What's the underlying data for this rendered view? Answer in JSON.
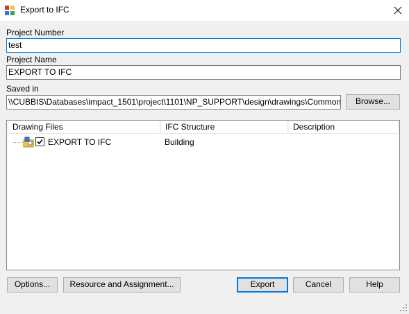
{
  "window": {
    "title": "Export to IFC"
  },
  "form": {
    "project_number_label": "Project Number",
    "project_number_value": "test",
    "project_name_label": "Project Name",
    "project_name_value": "EXPORT TO IFC",
    "saved_in_label": "Saved in",
    "saved_in_value": "\\\\CUBBIS\\Databases\\impact_1501\\project\\1101\\NP_SUPPORT\\design\\drawings\\Common drawin",
    "browse_label": "Browse..."
  },
  "list": {
    "columns": [
      "Drawing Files",
      "IFC Structure",
      "Description"
    ],
    "rows": [
      {
        "name": "EXPORT TO IFC",
        "structure": "Building",
        "description": "",
        "checked": true
      }
    ]
  },
  "buttons": {
    "options": "Options...",
    "resource": "Resource and Assignment...",
    "export": "Export",
    "cancel": "Cancel",
    "help": "Help"
  },
  "icons": {
    "app": "app-icon",
    "close": "close-icon",
    "file": "drawing-file-icon",
    "grip": "resize-grip-icon"
  }
}
